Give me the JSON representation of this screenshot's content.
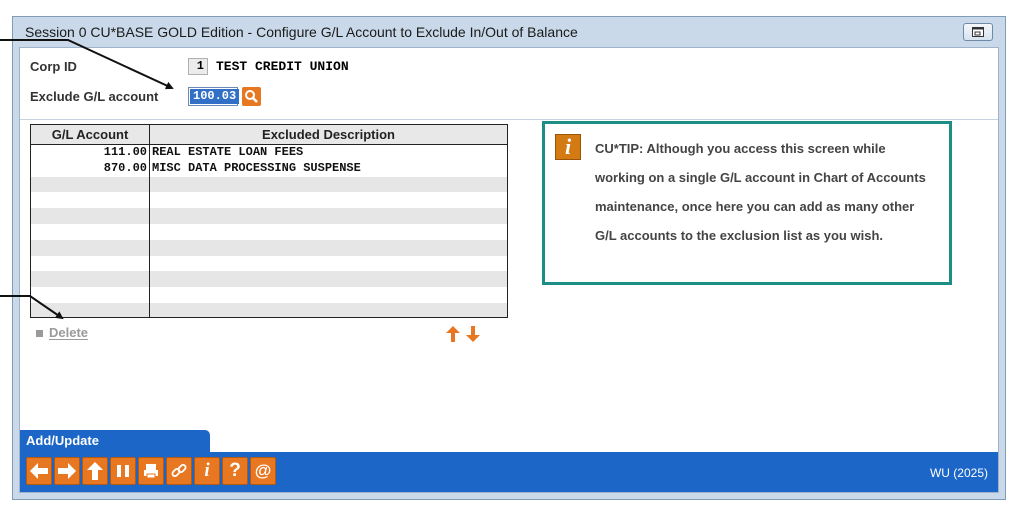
{
  "window": {
    "title": "Session 0 CU*BASE GOLD Edition - Configure G/L Account to Exclude In/Out of Balance"
  },
  "header": {
    "corp_id_label": "Corp ID",
    "corp_id_value": "1",
    "corp_name": "TEST CREDIT UNION",
    "exclude_label": "Exclude G/L account",
    "exclude_value": "100.03"
  },
  "grid": {
    "columns": [
      "G/L Account",
      "Excluded Description"
    ],
    "rows": [
      {
        "account": "111.00",
        "description": "REAL ESTATE LOAN FEES"
      },
      {
        "account": "870.00",
        "description": "MISC DATA PROCESSING SUSPENSE"
      }
    ]
  },
  "actions": {
    "delete_label": "Delete"
  },
  "tip": {
    "text": "CU*TIP: Although you access this screen while working on a single G/L account in Chart of Accounts maintenance, once here you can add as many other G/L accounts to the exclusion list as you wish."
  },
  "tab": {
    "label": "Add/Update"
  },
  "status": {
    "wu": "WU (2025)"
  },
  "colors": {
    "accent": "#1b66c6",
    "button": "#e87722",
    "tip_border": "#1d8e85"
  }
}
